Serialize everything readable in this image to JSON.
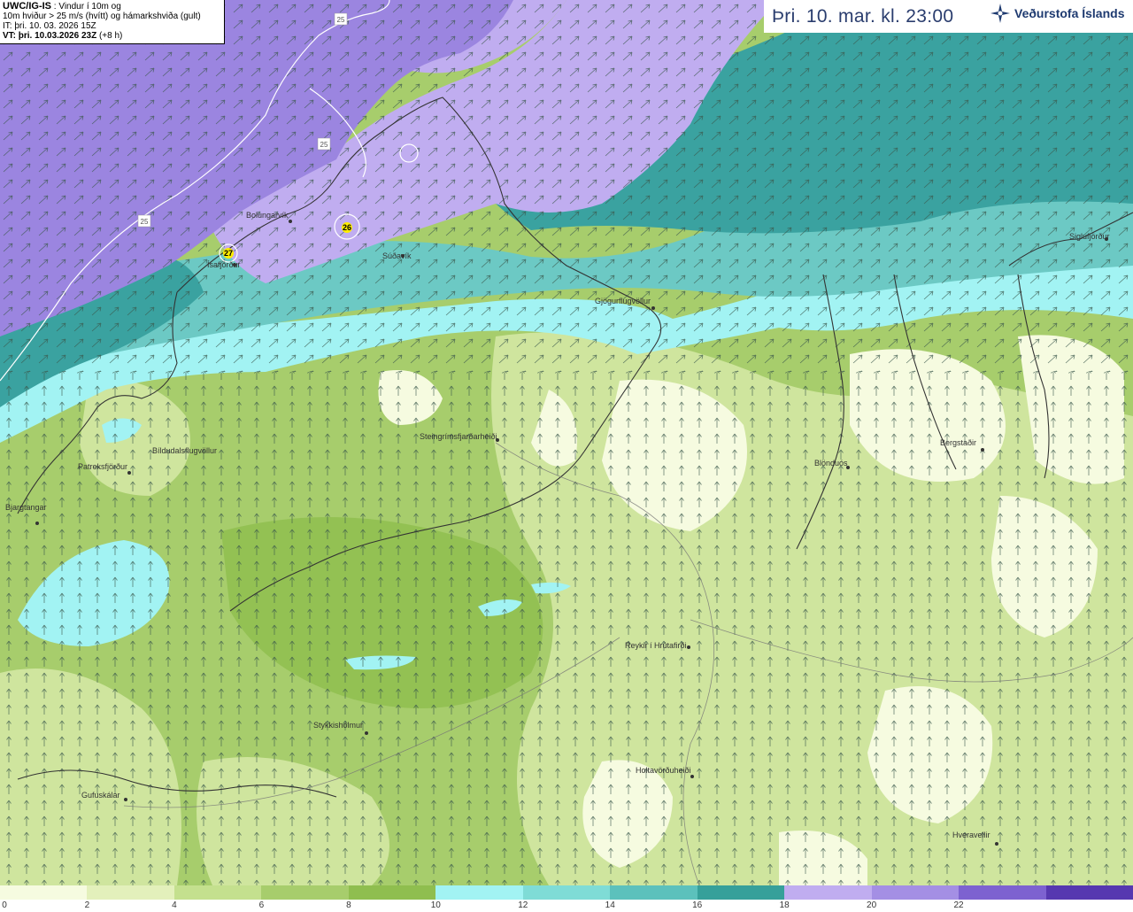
{
  "info": {
    "model": "UWC/IG-IS",
    "line1_rest": " : Vindur í 10m og",
    "line2": "10m hviður > 25 m/s (hvítt) og hámarkshviða (gult)",
    "it": "IT: þri. 10. 03. 2026 15Z",
    "vt_bold": "VT: þri. 10.03.2026 23Z",
    "vt_rest": " (+8 h)"
  },
  "title": {
    "date": "Þri. 10. mar. kl. 23:00",
    "logo_text": "Veðurstofa Íslands"
  },
  "colors": {
    "deep_purple": "#9b85e0",
    "light_purple": "#c0adf0",
    "dark_teal": "#3aa2a0",
    "mid_teal": "#6cc9c4",
    "cyan": "#a2f3f3",
    "green": "#a7cd6c",
    "light_green": "#cfe59e",
    "pale": "#f6fbe0",
    "coast": "#333333"
  },
  "places": [
    {
      "label": "Bolungarvík"
    },
    {
      "label": "Ísafjörður"
    },
    {
      "label": "Súðavík"
    },
    {
      "label": "Gjögurflugvöllur"
    },
    {
      "label": "Siglufjörður"
    },
    {
      "label": "Steingrímsfjarðarheiði"
    },
    {
      "label": "Bíldudalsflugvöllur"
    },
    {
      "label": "Patreksfjörður"
    },
    {
      "label": "Bjargtangar"
    },
    {
      "label": "Blönduós"
    },
    {
      "label": "Bergstaðir"
    },
    {
      "label": "Reykir í Hrútafirði"
    },
    {
      "label": "Stykkishólmur"
    },
    {
      "label": "Holtavörðuheiði"
    },
    {
      "label": "Gufuskálar"
    },
    {
      "label": "Hveravellir"
    }
  ],
  "gust_markers": [
    {
      "value": "27"
    },
    {
      "value": "26"
    }
  ],
  "isoline_labels": [
    {
      "value": "25"
    },
    {
      "value": "25"
    },
    {
      "value": "25"
    }
  ],
  "legend": {
    "labels": [
      "0",
      "2",
      "4",
      "6",
      "8",
      "10",
      "12",
      "14",
      "16",
      "18",
      "20",
      "22"
    ],
    "colors": [
      "#f6fbe0",
      "#e3f0bb",
      "#c4e08e",
      "#a7cd6c",
      "#8fbe4f",
      "#a2f3f3",
      "#7fdcd6",
      "#5cc1bc",
      "#36a09a",
      "#c0adf0",
      "#a48fe4",
      "#7d62d0",
      "#5638b0"
    ]
  }
}
